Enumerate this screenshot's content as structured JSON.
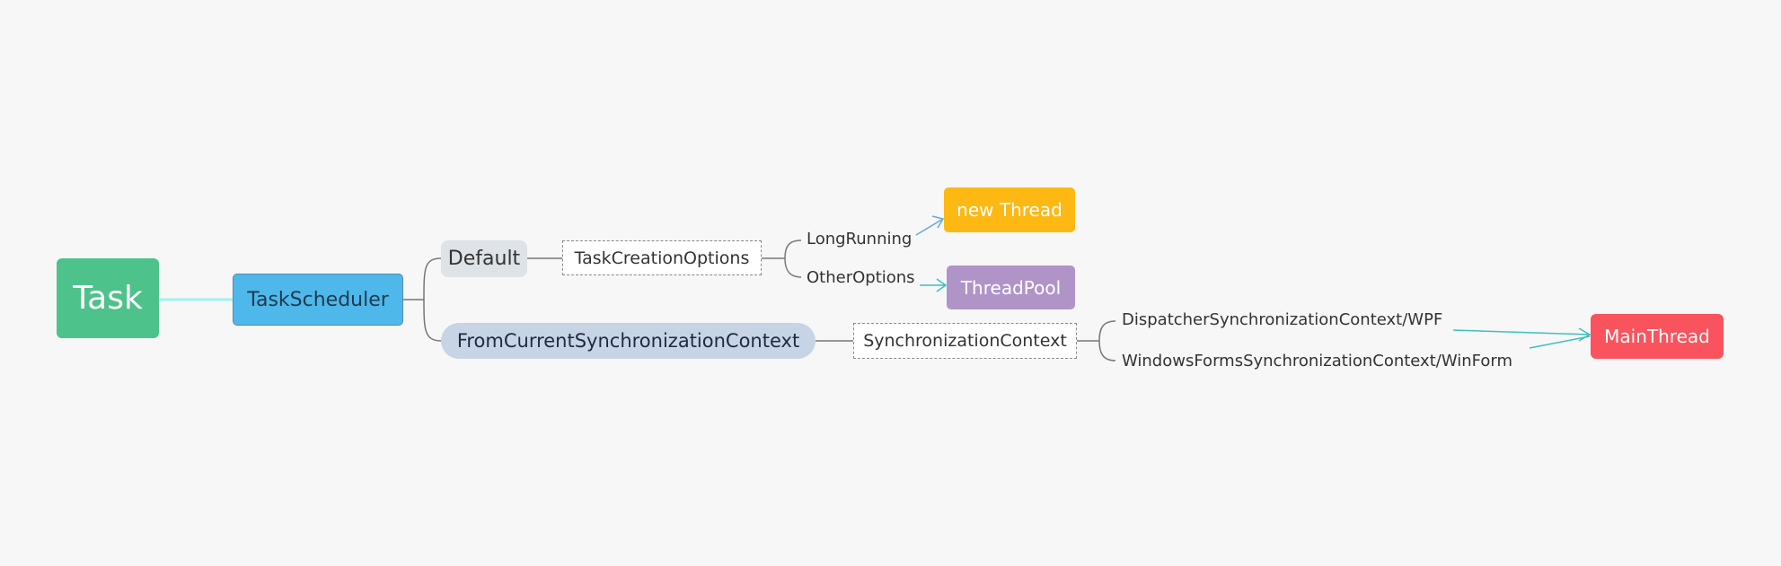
{
  "root": {
    "label": "Task",
    "color": "#4dc28a"
  },
  "scheduler": {
    "label": "TaskScheduler",
    "color": "#4fb8ea"
  },
  "default": {
    "label": "Default",
    "color": "#dde3e6"
  },
  "task_creation_options": {
    "label": "TaskCreationOptions"
  },
  "long_running": {
    "label": "LongRunning"
  },
  "other_options": {
    "label": "OtherOptions"
  },
  "new_thread": {
    "label": "new Thread",
    "color": "#fdb813"
  },
  "thread_pool": {
    "label": "ThreadPool",
    "color": "#b094c8"
  },
  "from_current": {
    "label": "FromCurrentSynchronizationContext",
    "color": "#c7d4e6"
  },
  "sync_context": {
    "label": "SynchronizationContext"
  },
  "dispatcher": {
    "label": "DispatcherSynchronizationContext/WPF"
  },
  "winforms": {
    "label": "WindowsFormsSynchronizationContext/WinForm"
  },
  "main_thread": {
    "label": "MainThread",
    "color": "#f9545e"
  }
}
